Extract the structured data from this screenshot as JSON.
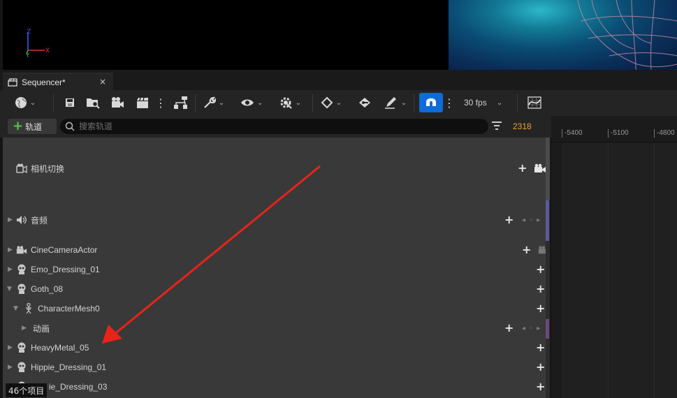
{
  "viewport": {
    "gizmo": {
      "z_label": "Z",
      "x_label": "X",
      "y_label": "Y"
    }
  },
  "tab": {
    "title": "Sequencer*",
    "close": "×",
    "icon": "clapper-icon"
  },
  "toolbar": {
    "fps_label": "30 fps",
    "buttons": [
      "world-icon",
      "save-icon",
      "browse-icon",
      "render-camera-icon",
      "clapper-icon",
      "more-icon",
      "hierarchy-icon",
      "wrench-icon",
      "eye-icon",
      "gear-icon",
      "key-diamond-icon",
      "key-icon",
      "pen-icon",
      "magnet-icon",
      "curve-editor-icon"
    ]
  },
  "search": {
    "add_track_label": "轨道",
    "placeholder": "搜索轨道",
    "frame_number": "2318"
  },
  "ruler": {
    "ticks": [
      "-5400",
      "-5100",
      "-4800"
    ]
  },
  "tracks": [
    {
      "label": "相机切换",
      "icon": "camera-cut-icon",
      "has_expander": false,
      "indent": 0,
      "has_camera": true,
      "has_keynav": false
    },
    {
      "label": "音频",
      "icon": "speaker-icon",
      "has_expander": true,
      "indent": 0,
      "has_camera": false,
      "has_keynav": true
    },
    {
      "label": "CineCameraActor",
      "icon": "cinecamera-icon",
      "has_expander": true,
      "indent": 0,
      "has_camera": true,
      "has_keynav": false
    },
    {
      "label": "Emo_Dressing_01",
      "icon": "skull-icon",
      "has_expander": true,
      "indent": 0,
      "has_camera": false,
      "has_keynav": false
    },
    {
      "label": "Goth_08",
      "icon": "skull-icon",
      "has_expander": true,
      "expanded": true,
      "indent": 0,
      "has_camera": false,
      "has_keynav": false
    },
    {
      "label": "CharacterMesh0",
      "icon": "skeleton-icon",
      "has_expander": true,
      "expanded": true,
      "indent": 1,
      "has_camera": false,
      "has_keynav": false
    },
    {
      "label": "动画",
      "icon": "",
      "has_expander": true,
      "indent": 2,
      "has_camera": false,
      "has_keynav": true
    },
    {
      "label": "HeavyMetal_05",
      "icon": "skull-icon",
      "has_expander": true,
      "indent": 0,
      "has_camera": false,
      "has_keynav": false
    },
    {
      "label": "Hippie_Dressing_01",
      "icon": "skull-icon",
      "has_expander": true,
      "indent": 0,
      "has_camera": false,
      "has_keynav": false
    },
    {
      "label": "ie_Dressing_03",
      "icon": "skull-icon",
      "has_expander": true,
      "indent": 0,
      "has_camera": false,
      "has_keynav": false
    }
  ],
  "status": {
    "item_count": "46个项目"
  },
  "colors": {
    "accent_blue": "#0e6bd8",
    "frame_orange": "#f0a030",
    "arrow_red": "#e8231a",
    "add_green": "#5fc84a"
  }
}
